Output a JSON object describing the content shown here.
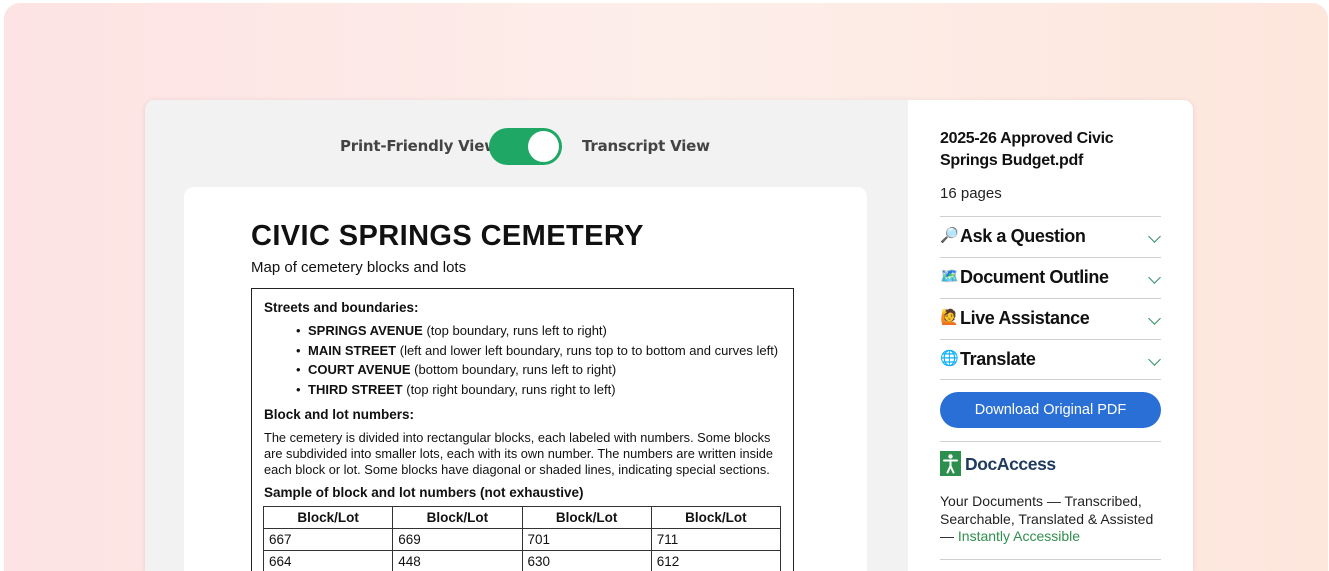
{
  "toggle": {
    "left_label": "Print-Friendly View",
    "right_label": "Transcript View",
    "state": "Transcript View"
  },
  "document": {
    "title": "CIVIC SPRINGS CEMETERY",
    "subtitle": "Map of cemetery blocks and lots",
    "streets_heading": "Streets and boundaries:",
    "streets": [
      {
        "name": "SPRINGS AVENUE",
        "desc": " (top boundary, runs left to right)"
      },
      {
        "name": "MAIN STREET",
        "desc": " (left and lower left boundary, runs top  to  to bottom and curves left)"
      },
      {
        "name": "COURT AVENUE",
        "desc": " (bottom boundary, runs left to right)"
      },
      {
        "name": "THIRD STREET",
        "desc": " (top right boundary, runs right to left)"
      }
    ],
    "lots_heading": "Block and lot numbers:",
    "lots_paragraph": "The cemetery is divided into rectangular blocks, each labeled with numbers. Some blocks are subdivided into smaller lots, each with its own number. The numbers are written inside each block or lot. Some blocks have diagonal or shaded lines, indicating special sections.",
    "sample_heading": "Sample of block and lot numbers (not exhaustive)",
    "table": {
      "headers": [
        "Block/Lot",
        "Block/Lot",
        "Block/Lot",
        "Block/Lot"
      ],
      "rows": [
        [
          "667",
          "669",
          "701",
          "711"
        ],
        [
          "664",
          "448",
          "630",
          "612"
        ]
      ]
    }
  },
  "sidebar": {
    "file_title": "2025-26 Approved Civic Springs Budget.pdf",
    "page_count": "16 pages",
    "accordions": [
      {
        "emoji": "🔎",
        "label": "Ask a Question"
      },
      {
        "emoji": "🗺️",
        "label": "Document Outline"
      },
      {
        "emoji": "🙋",
        "label": "Live Assistance"
      },
      {
        "emoji": "🌐",
        "label": "Translate"
      }
    ],
    "download_label": "Download Original PDF",
    "brand_name": "DocAccess",
    "tagline": "Your Documents — Transcribed, Searchable, Translated & Assisted — ",
    "tagline_link": "Instantly Accessible"
  },
  "colors": {
    "toggle_on": "#1fa865",
    "download_button": "#2a6fd6",
    "chevron": "#2f8f63",
    "brand_icon": "#2c8f4e",
    "brand_text": "#1f3a5f",
    "link": "#2f8f4e"
  }
}
